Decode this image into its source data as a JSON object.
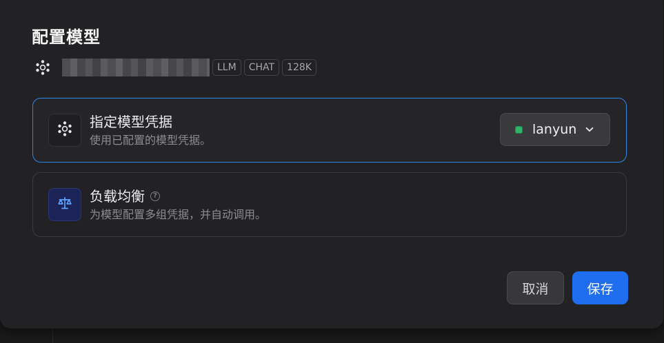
{
  "dialog": {
    "title": "配置模型"
  },
  "model": {
    "logo_icon": "model-provider-logo-icon",
    "name_redacted": true,
    "tags": [
      "LLM",
      "CHAT",
      "128K"
    ]
  },
  "options": {
    "credential": {
      "icon": "model-provider-logo-icon",
      "title": "指定模型凭据",
      "description": "使用已配置的模型凭据。",
      "selected_credential": "lanyun",
      "status_color": "#2fb36a",
      "selected": true
    },
    "load_balancing": {
      "icon": "scale-icon",
      "title": "负载均衡",
      "help_icon": "question-circle-icon",
      "description": "为模型配置多组凭据，并自动调用。",
      "selected": false
    }
  },
  "footer": {
    "cancel_label": "取消",
    "save_label": "保存"
  },
  "colors": {
    "accent": "#1f6ef0",
    "selected_border": "#2f86e6",
    "background": "#222225"
  }
}
